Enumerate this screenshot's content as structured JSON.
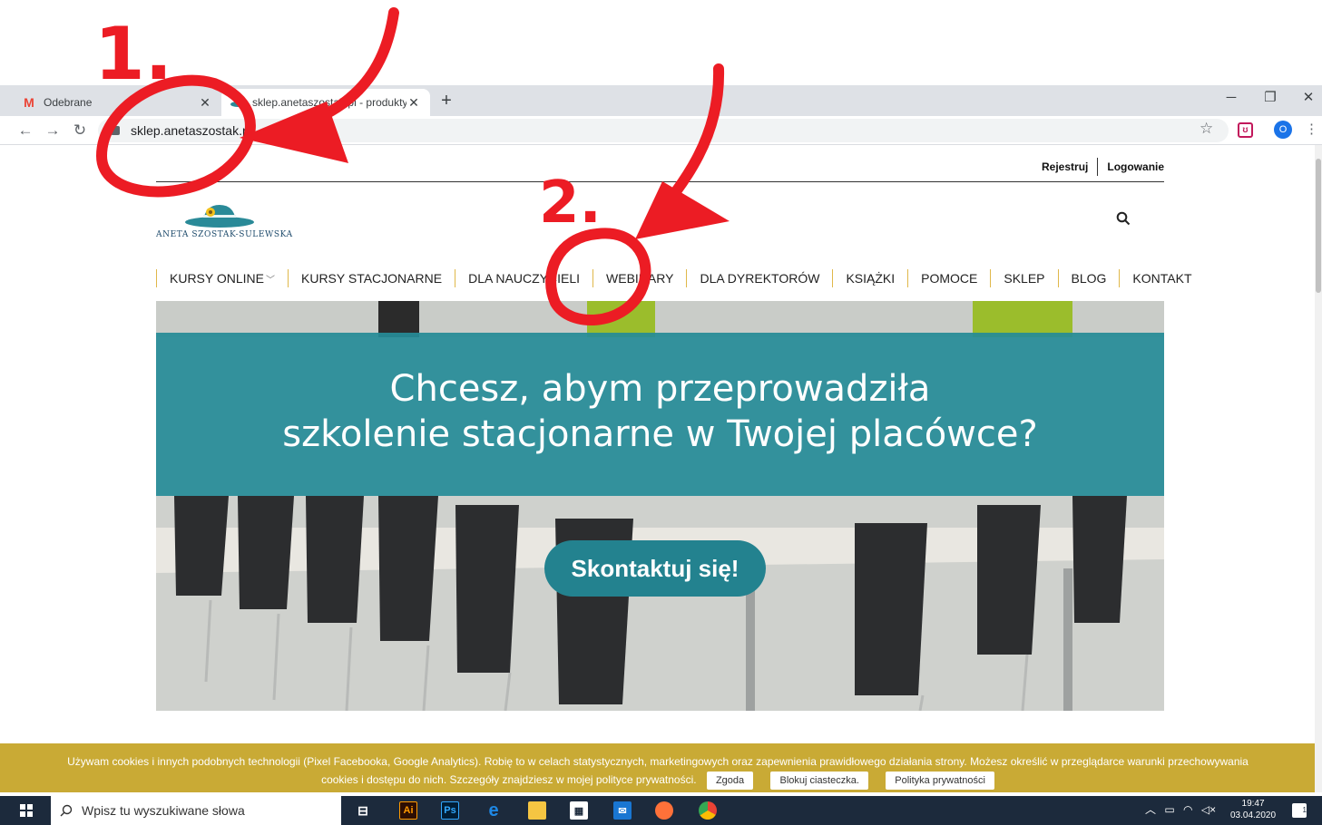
{
  "annotations": {
    "step1": "1.",
    "step2": "2."
  },
  "browser": {
    "tabs": [
      {
        "title": "Odebrane",
        "icon": "gmail-icon"
      },
      {
        "title": "sklep.anetaszostak.pl - produkty",
        "icon": "site-logo-icon"
      }
    ],
    "url": "sklep.anetaszostak.pl",
    "profile_initial": "O"
  },
  "site": {
    "user_links": {
      "register": "Rejestruj",
      "login": "Logowanie"
    },
    "logo_text": "ANETA SZOSTAK-SULEWSKA",
    "nav": [
      {
        "label": "KURSY ONLINE",
        "has_dropdown": true
      },
      {
        "label": "KURSY STACJONARNE"
      },
      {
        "label": "DLA NAUCZYCIELI"
      },
      {
        "label": "WEBINARY"
      },
      {
        "label": "DLA DYREKTORÓW"
      },
      {
        "label": "KSIĄŻKI"
      },
      {
        "label": "POMOCE"
      },
      {
        "label": "SKLEP"
      },
      {
        "label": "BLOG"
      },
      {
        "label": "KONTAKT"
      }
    ],
    "hero": {
      "title_line1": "Chcesz, abym przeprowadziła",
      "title_line2": "szkolenie stacjonarne w Twojej placówce?",
      "cta": "Skontaktuj się!"
    },
    "cookie": {
      "text_line1": "Używam cookies i innych podobnych technologii (Pixel Facebooka, Google Analytics). Robię to w celach statystycznych, marketingowych oraz zapewnienia prawidłowego działania strony. Możesz określić w przeglądarce warunki przechowywania",
      "text_line2": "cookies i dostępu do nich. Szczegóły znajdziesz w mojej polityce prywatności.",
      "accept": "Zgoda",
      "block": "Blokuj ciasteczka.",
      "policy": "Polityka prywatności"
    }
  },
  "taskbar": {
    "search_placeholder": "Wpisz tu wyszukiwane słowa",
    "time": "19:47",
    "date": "03.04.2020",
    "notification_count": "1"
  },
  "colors": {
    "annotation": "#ec1c24",
    "accent": "#268b97",
    "cookie": "#c9aa35",
    "nav_divider": "#e0b84a"
  }
}
